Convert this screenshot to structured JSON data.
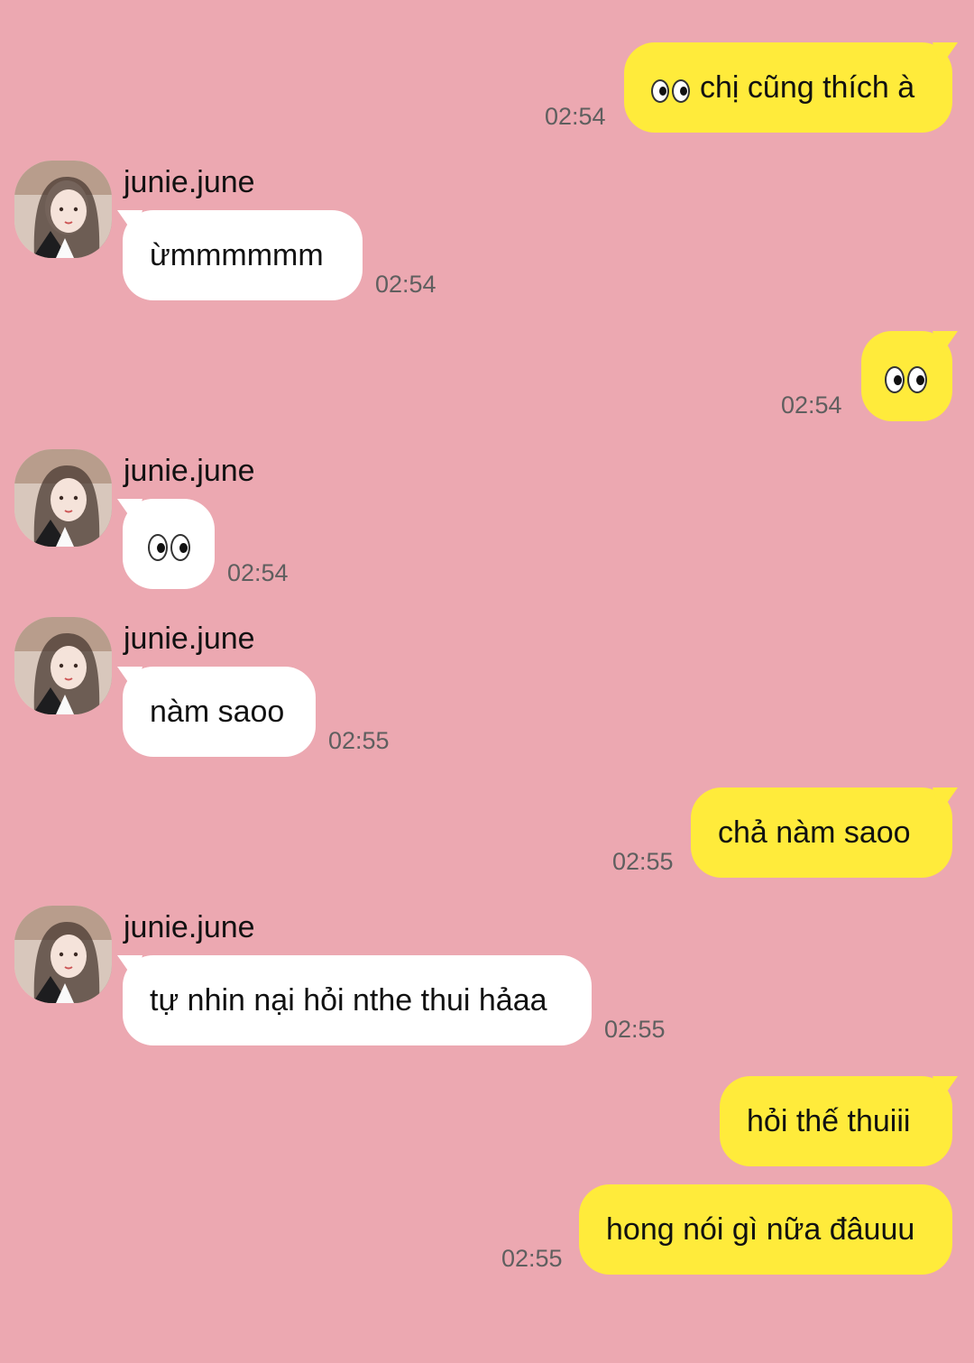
{
  "conversation": {
    "contact_name": "junie.june",
    "messages": [
      {
        "direction": "out",
        "text": "chị cũng thích à",
        "time": "02:54",
        "emoji": "eyes"
      },
      {
        "direction": "in",
        "text": "ừmmmmmm",
        "time": "02:54"
      },
      {
        "direction": "out",
        "text": "",
        "time": "02:54",
        "emoji": "eyes"
      },
      {
        "direction": "in",
        "text": "",
        "time": "02:54",
        "emoji": "eyes"
      },
      {
        "direction": "in",
        "text": "nàm saoo",
        "time": "02:55"
      },
      {
        "direction": "out",
        "text": "chả nàm saoo",
        "time": "02:55"
      },
      {
        "direction": "in",
        "text": "tự nhin nại hỏi nthe thui hảaa",
        "time": "02:55"
      },
      {
        "direction": "out",
        "text": "hỏi thế thuiii",
        "time": ""
      },
      {
        "direction": "out",
        "text": "hong nói gì nữa đâuuu",
        "time": "02:55"
      }
    ]
  },
  "colors": {
    "background": "#eca8b1",
    "outgoing_bubble": "#ffeb3b",
    "incoming_bubble": "#ffffff",
    "time_text": "#5f5f5f"
  },
  "icons": {
    "emoji": "eyes-emoji",
    "avatar": "profile-avatar"
  }
}
